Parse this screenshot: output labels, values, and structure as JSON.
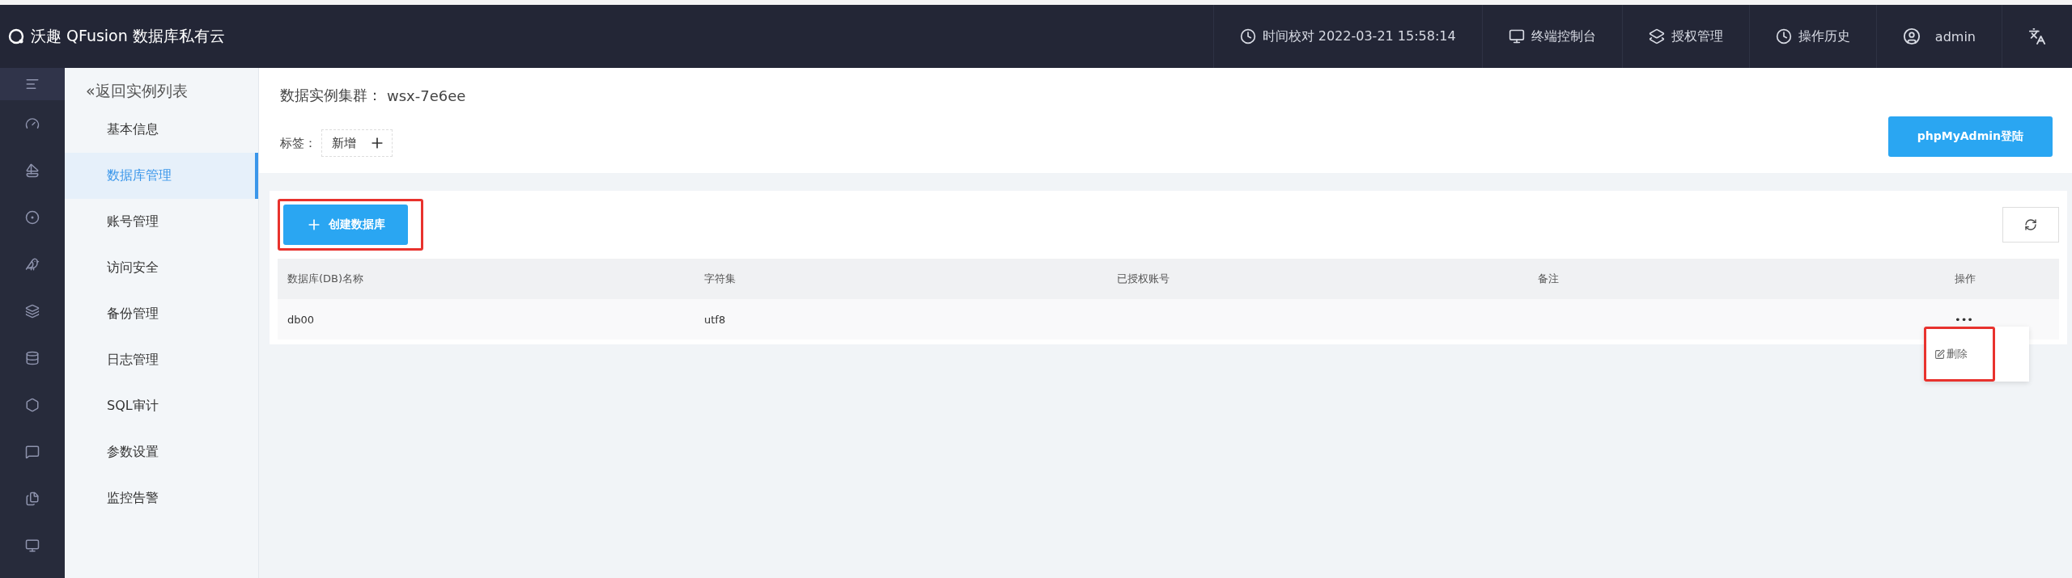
{
  "header": {
    "brand": "沃趣 QFusion 数据库私有云",
    "time_label": "时间校对 2022-03-21 15:58:14",
    "links": [
      "终端控制台",
      "授权管理",
      "操作历史"
    ],
    "user": "admin"
  },
  "rail": [
    {
      "selected": true
    },
    {
      "selected": false
    },
    {
      "selected": false
    },
    {
      "selected": false
    },
    {
      "selected": false
    },
    {
      "selected": false
    },
    {
      "selected": false
    },
    {
      "selected": false
    },
    {
      "selected": false
    },
    {
      "selected": false
    },
    {
      "selected": false
    }
  ],
  "submenu": {
    "back": "«返回实例列表",
    "items": [
      {
        "label": "基本信息",
        "selected": false
      },
      {
        "label": "数据库管理",
        "selected": true
      },
      {
        "label": "账号管理",
        "selected": false
      },
      {
        "label": "访问安全",
        "selected": false
      },
      {
        "label": "备份管理",
        "selected": false
      },
      {
        "label": "日志管理",
        "selected": false
      },
      {
        "label": "SQL审计",
        "selected": false
      },
      {
        "label": "参数设置",
        "selected": false
      },
      {
        "label": "监控告警",
        "selected": false
      }
    ]
  },
  "cluster": {
    "label": "数据实例集群：",
    "value": "wsx-7e6ee"
  },
  "tags": {
    "label": "标签：",
    "add": "新增"
  },
  "phpmyadmin_button": "phpMyAdmin登陆",
  "create_button": "创建数据库",
  "table": {
    "columns": [
      "数据库(DB)名称",
      "字符集",
      "已授权账号",
      "备注",
      "操作"
    ],
    "rows": [
      {
        "name": "db00",
        "charset": "utf8",
        "more": "•••"
      }
    ]
  },
  "row_menu": {
    "items": [
      "删除"
    ]
  }
}
